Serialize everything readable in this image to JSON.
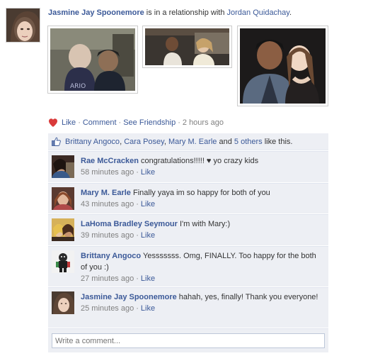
{
  "story": {
    "actor": "Jasmine Jay Spoonemore",
    "verb": " is in a relationship with ",
    "partner": "Jordan Quidachay",
    "end": "."
  },
  "actions": {
    "like": "Like",
    "comment": "Comment",
    "see_friendship": "See Friendship",
    "time": "2 hours ago",
    "separator": "·"
  },
  "likes": {
    "names": [
      "Brittany Angoco",
      "Cara Posey",
      "Mary M. Earle"
    ],
    "sep1": ", ",
    "sep2": ", ",
    "and": " and ",
    "others": "5 others",
    "suffix": " like this."
  },
  "comments": [
    {
      "name": "Rae McCracken",
      "text": " congratulations!!!!! ♥ yo crazy kids",
      "time": "58 minutes ago",
      "like": "Like"
    },
    {
      "name": "Mary M. Earle",
      "text": " Finally yaya im so happy for both of you",
      "time": "43 minutes ago",
      "like": "Like"
    },
    {
      "name": "LaHoma Bradley Seymour",
      "text": " I'm with Mary:)",
      "time": "39 minutes ago",
      "like": "Like"
    },
    {
      "name": "Brittany Angoco",
      "text": " Yesssssss. Omg, FINALLY. Too happy for the both of you :)",
      "time": "27 minutes ago",
      "like": "Like"
    },
    {
      "name": "Jasmine Jay Spoonemore",
      "text": " hahah, yes, finally! Thank you everyone!",
      "time": "25 minutes ago",
      "like": "Like"
    }
  ],
  "composer": {
    "placeholder": "Write a comment..."
  }
}
